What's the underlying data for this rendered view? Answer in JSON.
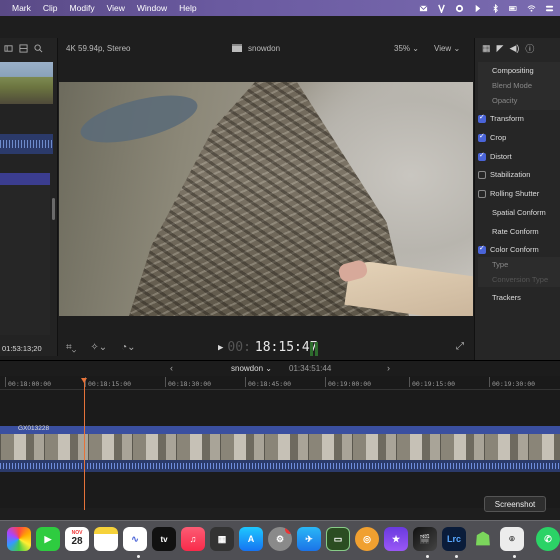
{
  "menubar": {
    "items": [
      "Mark",
      "Clip",
      "Modify",
      "View",
      "Window",
      "Help"
    ]
  },
  "browser": {
    "timecode": "01:53:13;20"
  },
  "viewer": {
    "format": "4K 59.94p, Stereo",
    "project_name": "snowdon",
    "zoom": "35%",
    "view_label": "View",
    "timecode_dim": "00:",
    "timecode": "18:15:47"
  },
  "inspector": {
    "compositing": "Compositing",
    "blend_mode": "Blend Mode",
    "opacity": "Opacity",
    "transform": "Transform",
    "crop": "Crop",
    "distort": "Distort",
    "stabilization": "Stabilization",
    "rolling_shutter": "Rolling Shutter",
    "spatial_conform": "Spatial Conform",
    "rate_conform": "Rate Conform",
    "color_conform": "Color Conform",
    "type": "Type",
    "conversion_type": "Conversion Type",
    "trackers": "Trackers"
  },
  "timeline": {
    "project_name": "snowdon",
    "duration": "01:34:51:44",
    "ruler": [
      "00:18:00:00",
      "00:18:15:00",
      "00:18:30:00",
      "00:18:45:00",
      "00:19:00:00",
      "00:19:15:00",
      "00:19:30:00"
    ],
    "clip_name": "GX013228"
  },
  "tooltip": "Screenshot",
  "dock": {
    "calendar_month": "NOV",
    "calendar_day": "28",
    "appletv_label": "tv",
    "lrc_label": "Lrc",
    "badge_count": "1",
    "icons": [
      "photos-icon",
      "facetime-icon",
      "calendar-icon",
      "notes-icon",
      "freeform-icon",
      "appletv-icon",
      "music-icon",
      "mission-control-icon",
      "appstore-icon",
      "settings-icon",
      "testflight-icon",
      "screenflow-icon",
      "cleanmymac-icon",
      "istat-icon",
      "final-cut-pro-icon",
      "lightroom-classic-icon",
      "android-studio-icon",
      "screenshot-app-icon",
      "whatsapp-icon"
    ],
    "colors": {
      "menubar": "#6a5aa0",
      "selection": "#3b3d8f",
      "checkbox": "#4a64d8",
      "playhead": "#e5733a",
      "clip_header": "#3a4fa0"
    }
  }
}
